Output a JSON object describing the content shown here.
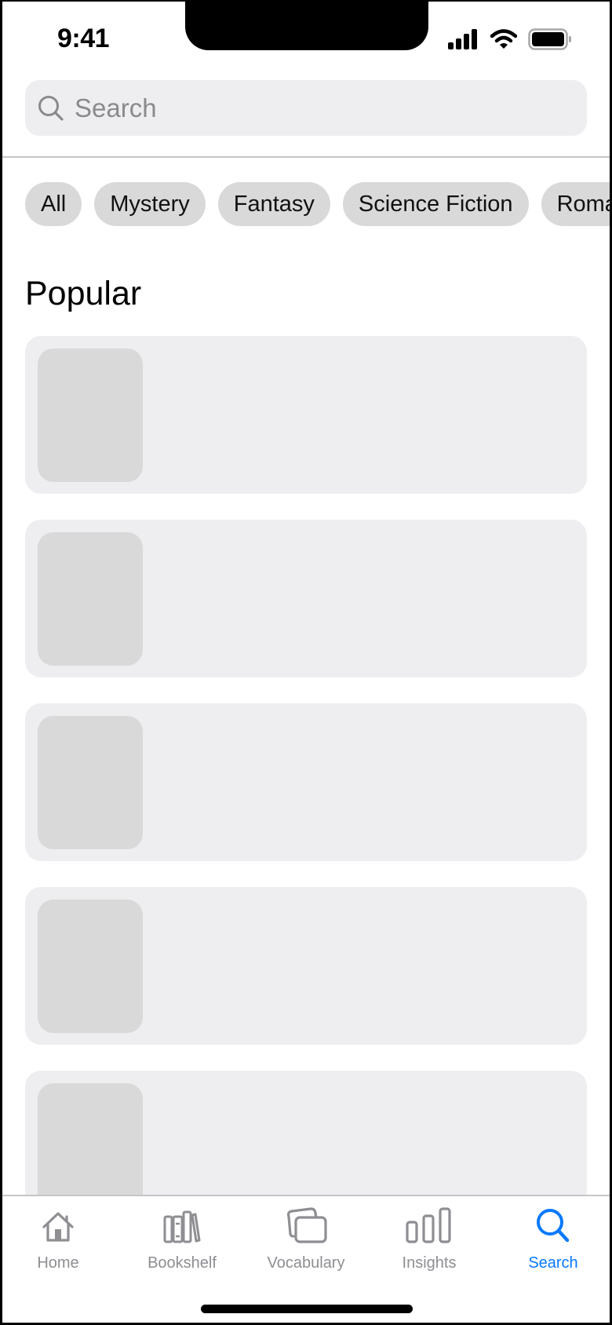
{
  "status_bar": {
    "time": "9:41",
    "icons": [
      "cellular-signal-icon",
      "wifi-icon",
      "battery-icon"
    ]
  },
  "search": {
    "placeholder": "Search",
    "value": "",
    "icon": "search-icon"
  },
  "filters": {
    "chips": [
      {
        "label": "All"
      },
      {
        "label": "Mystery"
      },
      {
        "label": "Fantasy"
      },
      {
        "label": "Science Fiction"
      },
      {
        "label": "Romance"
      }
    ]
  },
  "popular": {
    "title": "Popular",
    "items": [
      {
        "state": "loading-placeholder"
      },
      {
        "state": "loading-placeholder"
      },
      {
        "state": "loading-placeholder"
      },
      {
        "state": "loading-placeholder"
      },
      {
        "state": "loading-placeholder"
      }
    ]
  },
  "tabbar": {
    "active_color": "#0A7AFF",
    "inactive_color": "#8E8E93",
    "tabs": [
      {
        "label": "Home",
        "icon": "house-icon",
        "active": false
      },
      {
        "label": "Bookshelf",
        "icon": "books-icon",
        "active": false
      },
      {
        "label": "Vocabulary",
        "icon": "cards-icon",
        "active": false
      },
      {
        "label": "Insights",
        "icon": "bar-chart-icon",
        "active": false
      },
      {
        "label": "Search",
        "icon": "search-icon",
        "active": true
      }
    ]
  }
}
